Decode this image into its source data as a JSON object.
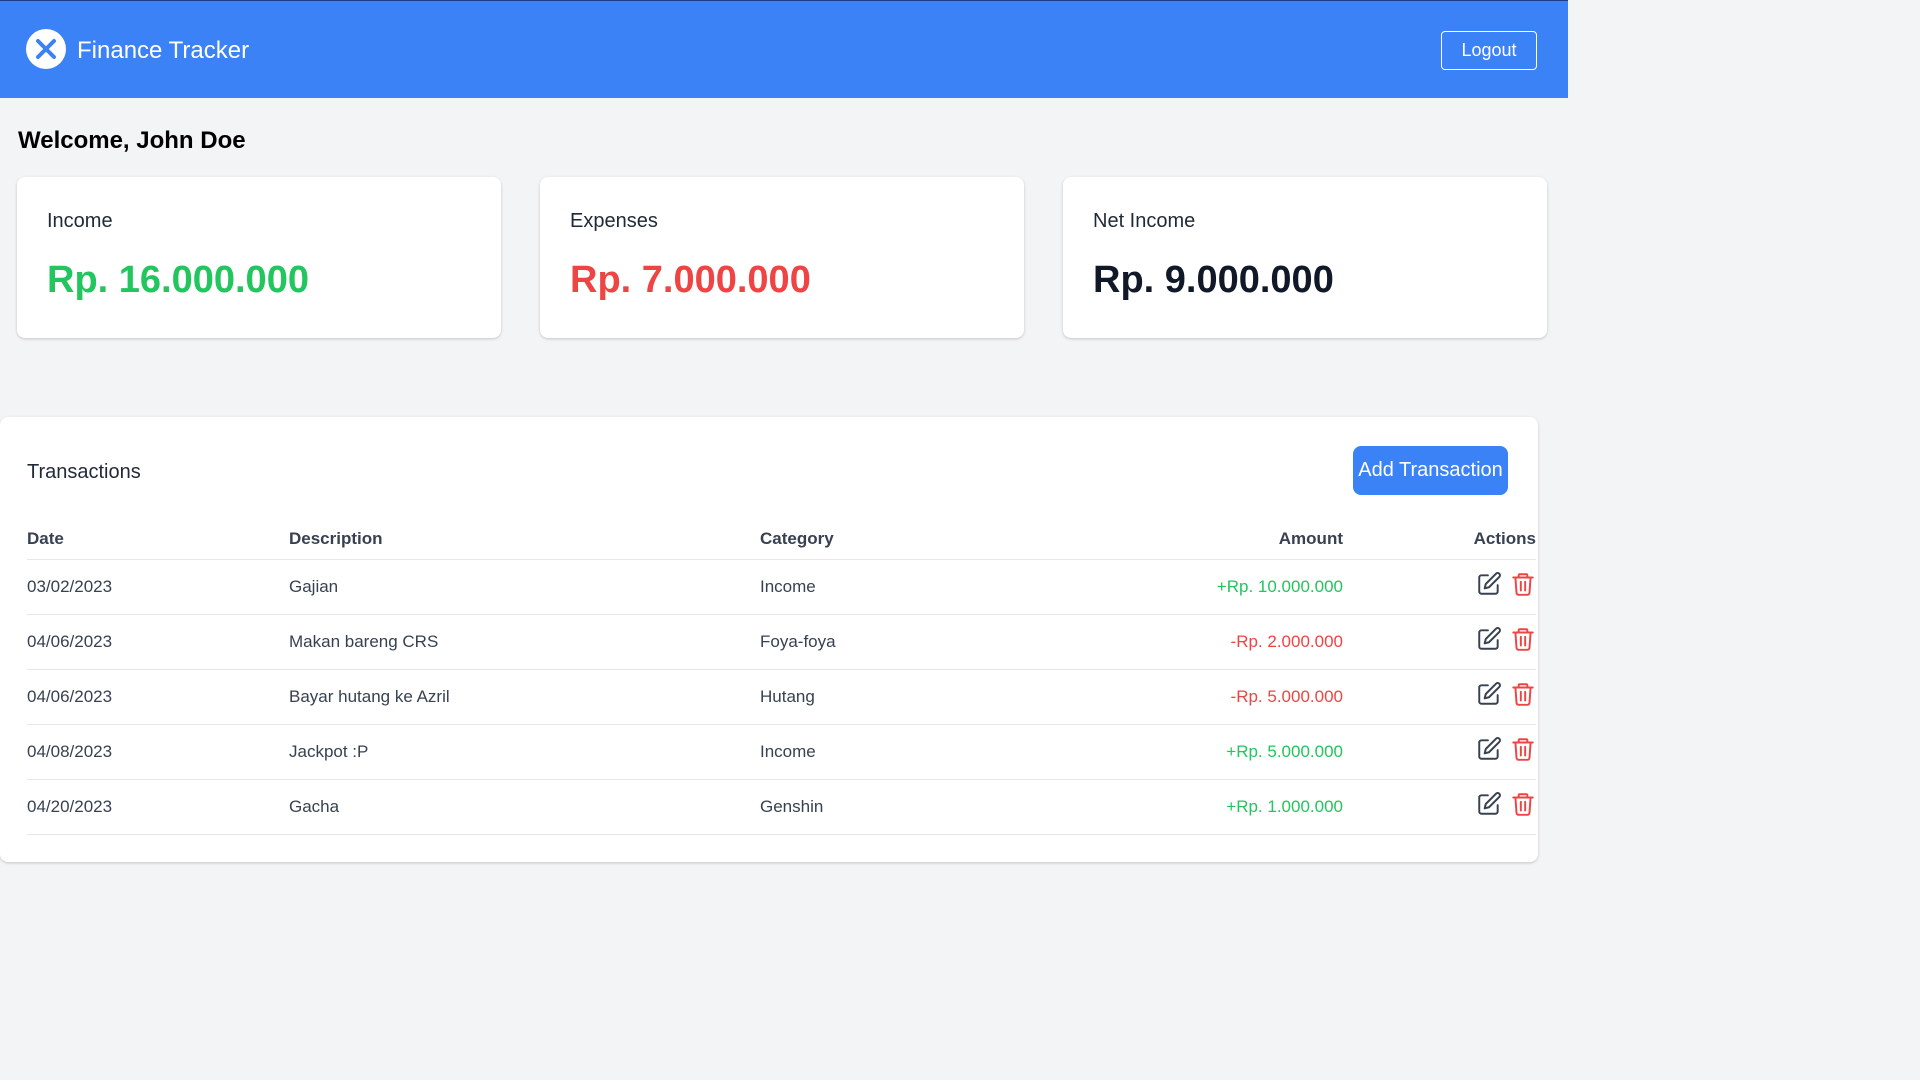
{
  "header": {
    "title": "Finance Tracker",
    "logout_label": "Logout",
    "background": "#3b82f6"
  },
  "welcome": "Welcome, John Doe",
  "summary": {
    "income": {
      "label": "Income",
      "value": "Rp. 16.000.000",
      "color": "#22c55e"
    },
    "expenses": {
      "label": "Expenses",
      "value": "Rp. 7.000.000",
      "color": "#ef4444"
    },
    "net": {
      "label": "Net Income",
      "value": "Rp. 9.000.000",
      "color": "#111827"
    }
  },
  "transactions": {
    "title": "Transactions",
    "add_label": "Add Transaction",
    "headers": {
      "date": "Date",
      "description": "Description",
      "category": "Category",
      "amount": "Amount",
      "actions": "Actions"
    },
    "rows": [
      {
        "date": "03/02/2023",
        "description": "Gajian",
        "category": "Income",
        "amount": "+Rp. 10.000.000",
        "type": "income"
      },
      {
        "date": "04/06/2023",
        "description": "Makan bareng CRS",
        "category": "Foya-foya",
        "amount": "-Rp. 2.000.000",
        "type": "expense"
      },
      {
        "date": "04/06/2023",
        "description": "Bayar hutang ke Azril",
        "category": "Hutang",
        "amount": "-Rp. 5.000.000",
        "type": "expense"
      },
      {
        "date": "04/08/2023",
        "description": "Jackpot :P",
        "category": "Income",
        "amount": "+Rp. 5.000.000",
        "type": "income"
      },
      {
        "date": "04/20/2023",
        "description": "Gacha",
        "category": "Genshin",
        "amount": "+Rp. 1.000.000",
        "type": "income"
      }
    ],
    "icons": {
      "edit": "edit-icon",
      "delete": "trash-icon"
    },
    "colors": {
      "income": "#22c55e",
      "expense": "#ef4444",
      "delete_icon": "#ef4444",
      "edit_icon": "#374151"
    }
  }
}
